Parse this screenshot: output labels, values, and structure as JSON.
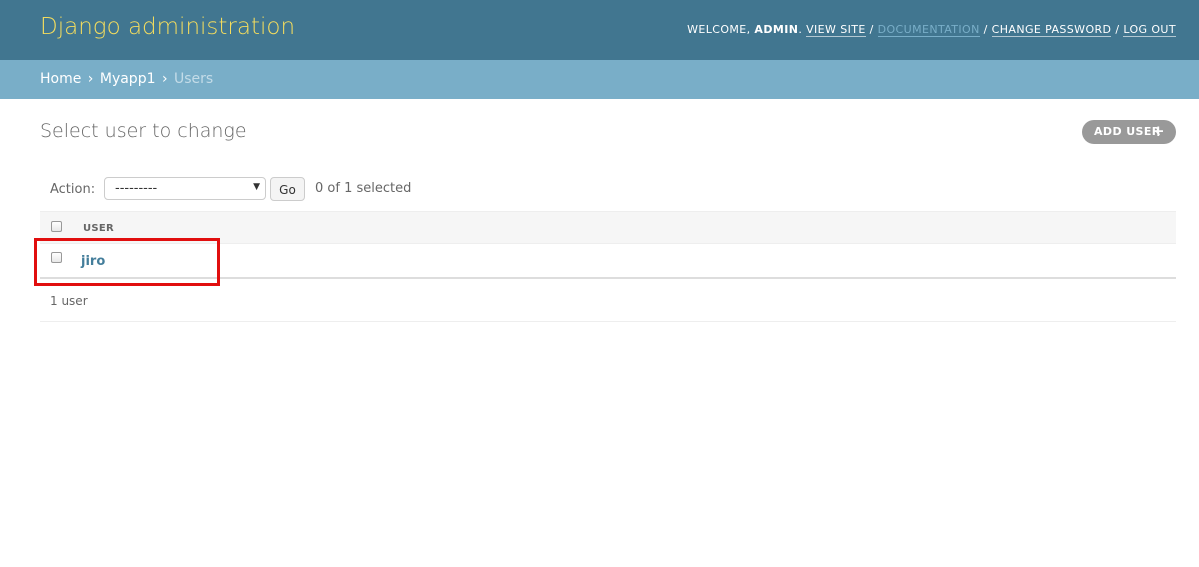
{
  "header": {
    "branding": "Django administration",
    "welcome": "WELCOME,",
    "username": "ADMIN",
    "view_site": "VIEW SITE",
    "documentation": "DOCUMENTATION",
    "change_password": "CHANGE PASSWORD",
    "log_out": "LOG OUT",
    "separator": "/"
  },
  "breadcrumbs": {
    "home": "Home",
    "app": "Myapp1",
    "current": "Users",
    "arrow": "›"
  },
  "content": {
    "title": "Select user to change",
    "add_button": "ADD USER",
    "add_icon": "plus-icon"
  },
  "actions": {
    "label": "Action:",
    "selected_option": "---------",
    "go_label": "Go",
    "selected_count": "0 of 1 selected"
  },
  "table": {
    "columns": [
      "USER"
    ],
    "rows": [
      {
        "user": "jiro"
      }
    ]
  },
  "paginator": {
    "count_text": "1 user"
  },
  "colors": {
    "header_bg": "#417690",
    "branding": "#f5dd5d",
    "breadcrumb_bg": "#79aec8",
    "link": "#447e9b",
    "highlight_box": "#e10e0e"
  }
}
